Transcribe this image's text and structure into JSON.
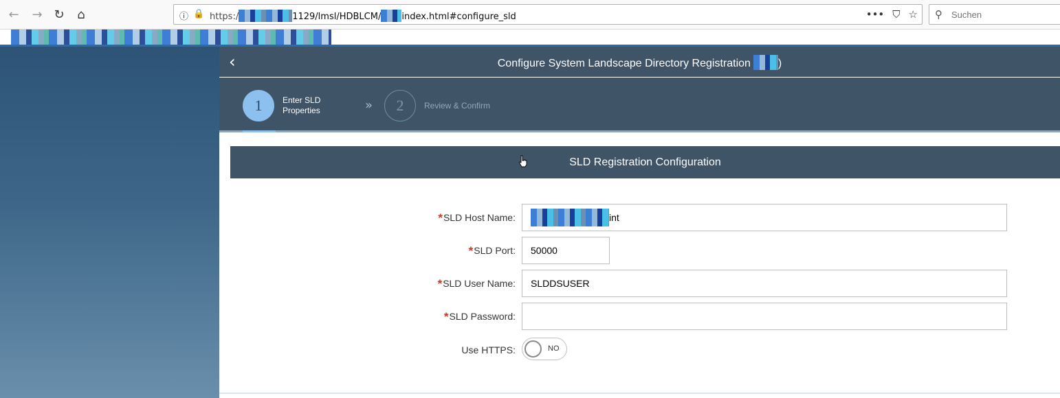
{
  "browser": {
    "url_prefix": "https:/",
    "url_middle": "1129/lmsl/HDBLCM/",
    "url_suffix": "index.html#configure_sld",
    "search_placeholder": "Suchen",
    "more_icon": "•••"
  },
  "page": {
    "title": "Configure System Landscape Directory Registration",
    "title_suffix": ")",
    "steps": [
      {
        "number": "1",
        "label": "Enter SLD Properties",
        "state": "active"
      },
      {
        "number": "2",
        "label": "Review & Confirm",
        "state": "inactive"
      }
    ],
    "section_title": "SLD Registration Configuration",
    "form": {
      "host_label": "SLD Host Name:",
      "host_value_suffix": "int",
      "port_label": "SLD Port:",
      "port_value": "50000",
      "user_label": "SLD User Name:",
      "user_value": "SLDDSUSER",
      "password_label": "SLD Password:",
      "password_value": "",
      "https_label": "Use HTTPS:",
      "https_toggle_text": "NO",
      "required_mark": "*"
    }
  },
  "colors": {
    "header_bg": "#3f5467",
    "accent_step": "#8cc0ee",
    "required": "#c0392b",
    "sidebar_top": "#2d5476",
    "sidebar_bottom": "#6a8fac"
  }
}
